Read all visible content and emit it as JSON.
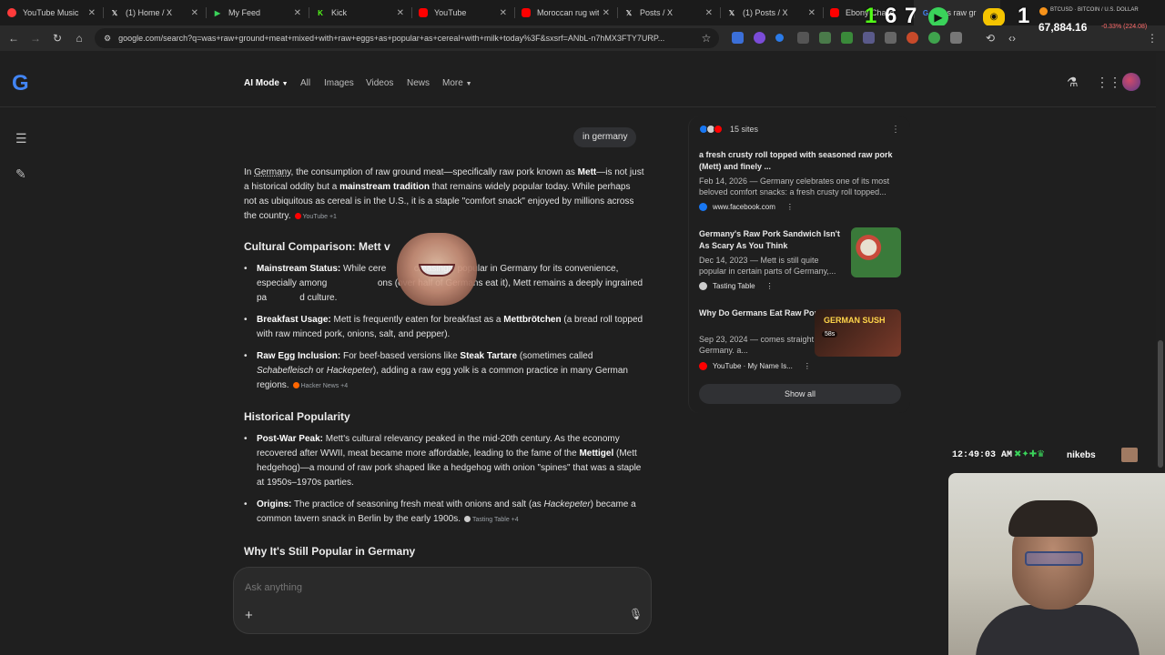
{
  "browser": {
    "tabs": [
      {
        "title": "YouTube Music",
        "color": "#ff3b3b",
        "icon": "youtube-music-icon"
      },
      {
        "title": "(1) Home / X",
        "color": "#ffffff",
        "icon": "x-icon"
      },
      {
        "title": "My Feed",
        "color": "#3ad35a",
        "icon": "play-icon"
      },
      {
        "title": "Kick",
        "color": "#53fc18",
        "icon": "kick-icon"
      },
      {
        "title": "YouTube",
        "color": "#ff0000",
        "icon": "youtube-icon"
      },
      {
        "title": "Moroccan rug wit",
        "color": "#ff0000",
        "icon": "youtube-icon"
      },
      {
        "title": "Posts / X",
        "color": "#ffffff",
        "icon": "x-icon"
      },
      {
        "title": "(1) Posts / X",
        "color": "#ffffff",
        "icon": "x-icon"
      },
      {
        "title": "Ebony Challe",
        "color": "#ff0000",
        "icon": "youtube-icon"
      },
      {
        "title": "was raw gr",
        "color": "#4285f4",
        "icon": "google-icon"
      }
    ],
    "url": "google.com/search?q=was+raw+ground+meat+mixed+with+raw+eggs+as+popular+as+cereal+with+milk+today%3F&sxsrf=ANbL-n7hMX3FTY7URP...",
    "ticker": {
      "symbol": "BTCUSD · BITCOIN / U.S. DOLLAR",
      "price": "67,884.16",
      "change": "-0.33% (224.08)"
    },
    "overlay_numbers": [
      "1",
      "6",
      "7",
      "1"
    ]
  },
  "google": {
    "logo": "G",
    "tabs": [
      "AI Mode",
      "All",
      "Images",
      "Videos",
      "News",
      "More"
    ]
  },
  "conversation": {
    "user_chip": "in germany",
    "intro": {
      "p1": "In ",
      "germany": "Germany",
      "p2": ", the consumption of raw ground meat—specifically raw pork known as ",
      "mett": "Mett",
      "p3": "—is not just a historical oddity but a ",
      "tradition": "mainstream tradition",
      "p4": " that remains widely popular today. While perhaps not as ubiquitous as cereal is in the U.S., it is a staple \"comfort snack\" enjoyed by millions across the country.",
      "cite": "YouTube +1"
    },
    "section1": {
      "heading": "Cultural Comparison: Mett v",
      "bullets": [
        {
          "label": "Mainstream Status:",
          "text": " While cere           creasingly popular in Germany for its convenience, especially among                    ons (over half of Germans eat it), Mett remains a deeply ingrained pa             d culture."
        },
        {
          "label": "Breakfast Usage:",
          "text": " Mett is frequently eaten for breakfast as a ",
          "bold2": "Mettbrötchen",
          "text2": " (a bread roll topped with raw minced pork, onions, salt, and pepper)."
        },
        {
          "label": "Raw Egg Inclusion:",
          "text": " For beef-based versions like ",
          "bold2": "Steak Tartare",
          "text2": " (sometimes called ",
          "ital1": "Schabefleisch",
          "text3": " or ",
          "ital2": "Hackepeter",
          "text4": "), adding a raw egg yolk is a common practice in many German regions.",
          "cite": "Hacker News +4"
        }
      ]
    },
    "section2": {
      "heading": "Historical Popularity",
      "bullets": [
        {
          "label": "Post-War Peak:",
          "text": " Mett's cultural relevancy peaked in the mid-20th century. As the economy recovered after WWII, meat became more affordable, leading to the fame of the ",
          "bold2": "Mettigel",
          "text2": " (Mett hedgehog)—a mound of raw pork shaped like a hedgehog with onion \"spines\" that was a staple at 1950s–1970s parties."
        },
        {
          "label": "Origins:",
          "text": " The practice of seasoning fresh meat with onions and salt (as ",
          "ital1": "Hackepeter",
          "text2": ") became a common tavern snack in Berlin by the early 1900s.",
          "cite": "Tasting Table +4"
        }
      ]
    },
    "section3": {
      "heading": "Why It's Still Popular in Germany"
    },
    "ask": {
      "placeholder": "Ask anything"
    }
  },
  "sources": {
    "count_label": "15 sites",
    "cards": [
      {
        "title": "a fresh crusty roll topped with seasoned raw pork (Mett) and finely ...",
        "snippet": "Feb 14, 2026 — Germany celebrates one of its most beloved comfort snacks: a fresh crusty roll topped...",
        "source": "www.facebook.com",
        "source_color": "#1877f2"
      },
      {
        "title": "Germany's Raw Pork Sandwich Isn't As Scary As You Think",
        "snippet": "Dec 14, 2023 — Mett is still quite popular in certain parts of Germany,...",
        "source": "Tasting Table",
        "source_color": "#cccccc"
      },
      {
        "title": "Why Do Germans Eat Raw Pork?",
        "snippet": "Sep 23, 2024 — comes straight out of Germany. a...",
        "source": "YouTube · My Name Is...",
        "source_color": "#ff0000",
        "badge": "58s",
        "thumb_text": "GERMAN SUSH"
      }
    ],
    "show_all": "Show all"
  },
  "stream": {
    "clock": "12:49:03 AM",
    "handle": "nikebs"
  }
}
